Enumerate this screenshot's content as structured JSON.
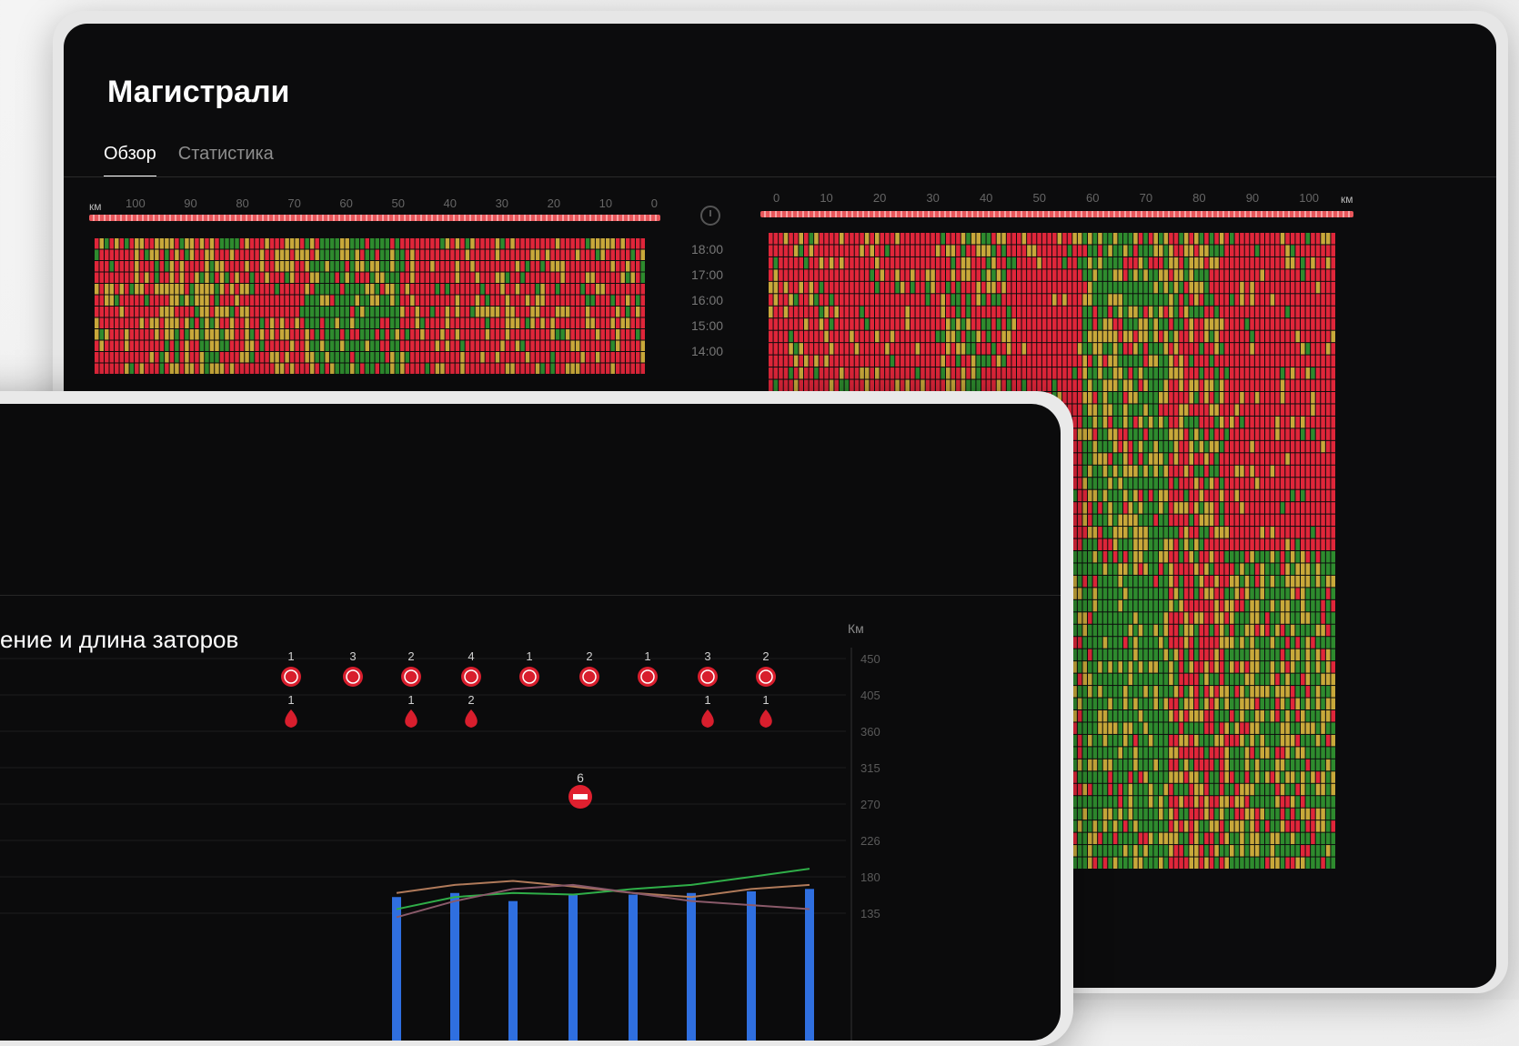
{
  "page_title": "Магистрали",
  "tabs": [
    {
      "label": "Обзор",
      "active": true
    },
    {
      "label": "Статистика",
      "active": false
    }
  ],
  "left_km_scale": {
    "unit": "км",
    "ticks": [
      "100",
      "90",
      "80",
      "70",
      "60",
      "50",
      "40",
      "30",
      "20",
      "10",
      "0"
    ]
  },
  "right_km_scale": {
    "unit": "км",
    "ticks": [
      "0",
      "10",
      "20",
      "30",
      "40",
      "50",
      "60",
      "70",
      "80",
      "90",
      "100"
    ]
  },
  "times": [
    "18:00",
    "17:00",
    "16:00",
    "15:00",
    "14:00"
  ],
  "colors": {
    "free": "#2e8b2e",
    "medium": "#c8a83a",
    "jam": "#e0263a",
    "accent": "#2f6fe0"
  },
  "section_title": "ение и длина заторов",
  "chart_data": {
    "type": "bar",
    "y_unit": "Км",
    "y_ticks": [
      "450",
      "405",
      "360",
      "315",
      "270",
      "226",
      "180",
      "135"
    ],
    "ylim": [
      135,
      450
    ],
    "accident_counts": [
      "1",
      "3",
      "2",
      "4",
      "1",
      "2",
      "1",
      "3",
      "2"
    ],
    "roadwork_counts": [
      "1",
      "",
      "1",
      "2",
      "",
      "",
      "",
      "1",
      "1"
    ],
    "closure": {
      "count": "6"
    },
    "series": [
      {
        "values": [
          160,
          170,
          175,
          168,
          160,
          155,
          165,
          170
        ]
      },
      {
        "values": [
          140,
          155,
          160,
          158,
          165,
          170,
          180,
          190
        ]
      },
      {
        "values": [
          130,
          150,
          165,
          170,
          160,
          150,
          145,
          140
        ]
      }
    ],
    "bar_values": [
      155,
      160,
      150,
      158,
      158,
      160,
      162,
      165
    ]
  }
}
